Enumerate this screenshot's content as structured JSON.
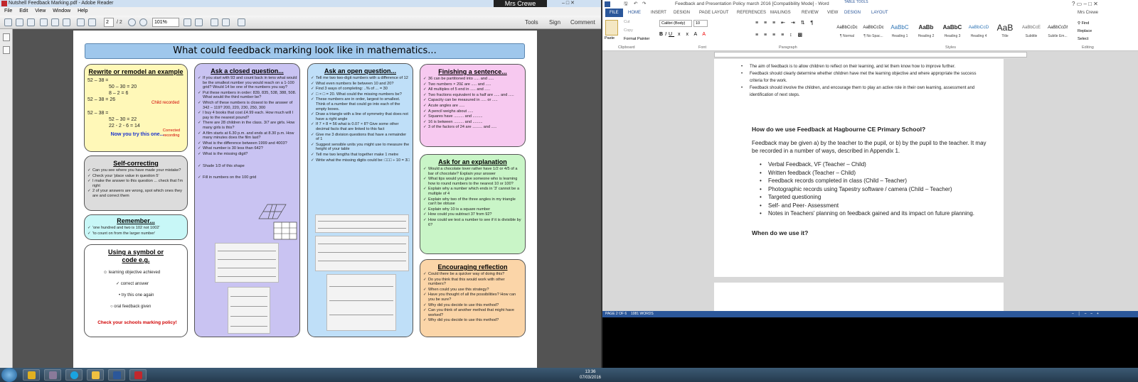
{
  "reader": {
    "title": "Nutshell Feedback Marking.pdf - Adobe Reader",
    "user": "Mrs Crewe",
    "win_buttons": "–  □  ✕",
    "menu": [
      "File",
      "Edit",
      "View",
      "Window",
      "Help"
    ],
    "page_current": "2",
    "page_total": "/ 2",
    "zoom": "101%",
    "tools": [
      "Tools",
      "Sign",
      "Comment"
    ]
  },
  "poster": {
    "title": "What could feedback marking look like in mathematics...",
    "colors": {
      "yellow": "#fff8b8",
      "grey": "#dcdcdc",
      "cyan": "#c8f7f7",
      "white": "#ffffff",
      "purple": "#c9c3f2",
      "blue": "#bfdff8",
      "pink": "#f7c9f0",
      "green": "#c9f5c7",
      "orange": "#fbd5a8"
    },
    "rewrite": {
      "title": "Rewrite or remodel an example",
      "lines": [
        "52 – 38 =",
        "50 – 30 = 20",
        "8 – 2 = 6",
        "52 – 38 = 26",
        "52 – 38 =",
        "52 – 30 = 22",
        "22 - 2 - 6 = 14"
      ],
      "note1": "Child recorded",
      "note2": "Corrected recording",
      "cta": "Now you try this one..."
    },
    "self": {
      "title": "Self-correcting",
      "items": [
        "Can you see where you have made your mistake?",
        "Check your 'place value in question 5'",
        "I make the answer to this question ... check that I'm right",
        "2 of your answers are wrong, spot which ones they are and correct them"
      ]
    },
    "remember": {
      "title": "Remember...",
      "items": [
        "'one hundred and two is 102 not 1002'",
        "'to count on from the larger number'"
      ]
    },
    "symbol": {
      "title": "Using a symbol or code e.g.",
      "items": [
        "learning objective achieved",
        "correct answer",
        "try this one again",
        "oral feedback given"
      ],
      "footer": "Check your schools marking policy!"
    },
    "closed": {
      "title": "Ask a closed question...",
      "items": [
        "If you start with 93 and count back in tens what would be the smallest number you would reach on a 1-100 grid? Would 14 be one of the numbers you say?",
        "Put these numbers in order: 839, 835, 538, 388, 508. What would the third number be?",
        "Which of these numbers is closest to the answer of 342 – 119? 200, 220, 230, 250, 300",
        "I buy 4 books that cost £4.99 each. How much will I pay to the nearest pound?",
        "There are 28 children in the class. 3/7 are girls. How many girls is this?",
        "A film starts at 6.30 p.m. and ends at 8.30 p.m. How many minutes does the film last?",
        "What is the difference between 1999 and 4003?",
        "What number is 30 less than 642?",
        "What is the missing digit?",
        "Shade 1/3 of this shape",
        "Fill in numbers on the 100 grid"
      ]
    },
    "open": {
      "title": "Ask an open question...",
      "items": [
        "Tell me two two-digit numbers with a difference of 12",
        "What even numbers lie between 10 and 20?",
        "Find 3 ways of completing: ..% of ... = 30",
        "□ × □ = 20. What could the missing numbers be?",
        "These numbers are in order, largest to smallest. Think of a number that could go into each of the empty boxes.",
        "Draw a triangle with a line of symmetry that does not have a right angle",
        "If 7 × 8 = 56 what is 0.07 × 8? Give some other decimal facts that are linked to this fact",
        "Give me 3 division questions that have a remainder of 1",
        "Suggest sensible units you might use to measure the height of your table",
        "Tell me two lengths that together make 1 metre",
        "Write what the missing digits could be: □□□ ÷ 10 = 3□"
      ]
    },
    "finish": {
      "title": "Finishing a sentence...",
      "items": [
        "36 can be partitioned into ..... and .....",
        "Two numbers × 20£ are ..... and .....",
        "All multiples of 5 end in ..... and .....",
        "Two fractions equivalent to a half are ..... and .....",
        "Capacity can be measured in ..... or .....",
        "Acute angles are .....",
        "A pencil weighs about .....",
        "Squares have ......... and .........",
        "16 is between ......... and .........",
        "3 of the factors of 24 are ......... and ....."
      ]
    },
    "explain": {
      "title": "Ask for an explanation",
      "items": [
        "Would a chocolate lover rather have 1/2 or 4/5 of a bar of chocolate? Explain your answer",
        "What tips would you give someone who is learning how to round numbers to the nearest 10 or 100?",
        "Explain why a number which ends in '3' cannot be a multiple of 4",
        "Explain why two of the three angles in my triangle can't be obtuse",
        "Explain why 10 is a square number",
        "How could you subtract 37 from 92?",
        "How could we test a number to see if it is divisible by 6?"
      ]
    },
    "reflect": {
      "title": "Encouraging reflection",
      "items": [
        "Could there be a quicker way of doing this?",
        "Do you think that this would work with other numbers?",
        "When could you use this strategy?",
        "Have you thought of all the possibilities? How can you be sure?",
        "Why did you decide to use this method?",
        "Can you think of another method that might have worked?",
        "Why did you decide to use this method?"
      ]
    }
  },
  "word": {
    "title": "Feedback and Presentation Policy march 2016 [Compatibility Mode] - Word",
    "table_tools": "TABLE TOOLS",
    "tabs": [
      "FILE",
      "HOME",
      "INSERT",
      "DESIGN",
      "PAGE LAYOUT",
      "REFERENCES",
      "MAILINGS",
      "REVIEW",
      "VIEW",
      "DESIGN",
      "LAYOUT"
    ],
    "user": "Mrs Crewe",
    "clipboard": [
      "Paste",
      "Cut",
      "Copy",
      "Format Painter"
    ],
    "font_name": "Calibri (Body)",
    "font_size": "10",
    "groups": [
      "Clipboard",
      "Font",
      "Paragraph",
      "Styles",
      "Editing"
    ],
    "editing": [
      "Find",
      "Replace",
      "Select"
    ],
    "styles": [
      {
        "sample": "AaBbCcDc",
        "name": "¶ Normal"
      },
      {
        "sample": "AaBbCcDc",
        "name": "¶ No Spac..."
      },
      {
        "sample": "AaBbC",
        "name": "Heading 1"
      },
      {
        "sample": "AaBb",
        "name": "Heading 2"
      },
      {
        "sample": "AaBbC",
        "name": "Heading 3"
      },
      {
        "sample": "AaBbCcD",
        "name": "Heading 4"
      },
      {
        "sample": "AaB",
        "name": "Title"
      },
      {
        "sample": "AaBbCcE",
        "name": "Subtitle"
      },
      {
        "sample": "AaBbCcDt",
        "name": "Subtle Em..."
      }
    ],
    "doc": {
      "bullets_top": [
        "The aim of feedback is to allow children to reflect on their learning, and let them know how to improve further.",
        "Feedback should clearly determine whether children have met the learning objective and where appropriate the success criteria for the work.",
        "Feedback should involve the children, and encourage them to play an active role in their own learning, assessment and identification of next steps."
      ],
      "heading1": "How do we use Feedback at Hagbourne CE Primary School?",
      "para": "Feedback may be given a) by the teacher to the pupil, or b) by the pupil to the teacher. It may be recorded in a number of ways, described in Appendix 1.",
      "bullets": [
        "Verbal Feedback, VF (Teacher – Child)",
        "Written feedback (Teacher – Child)",
        "Feedback records completed in class (Child – Teacher)",
        "Photographic records using Tapestry software / camera (Child – Teacher)",
        "Targeted questioning",
        "Self- and Peer- Assessment",
        "Notes in Teachers' planning on feedback gained and its impact on future planning."
      ],
      "heading2": "When do we use it?"
    },
    "status": {
      "page": "PAGE 2 OF 6",
      "words": "1081 WORDS"
    }
  },
  "taskbar": {
    "time": "13:36",
    "date": "07/03/2016"
  }
}
